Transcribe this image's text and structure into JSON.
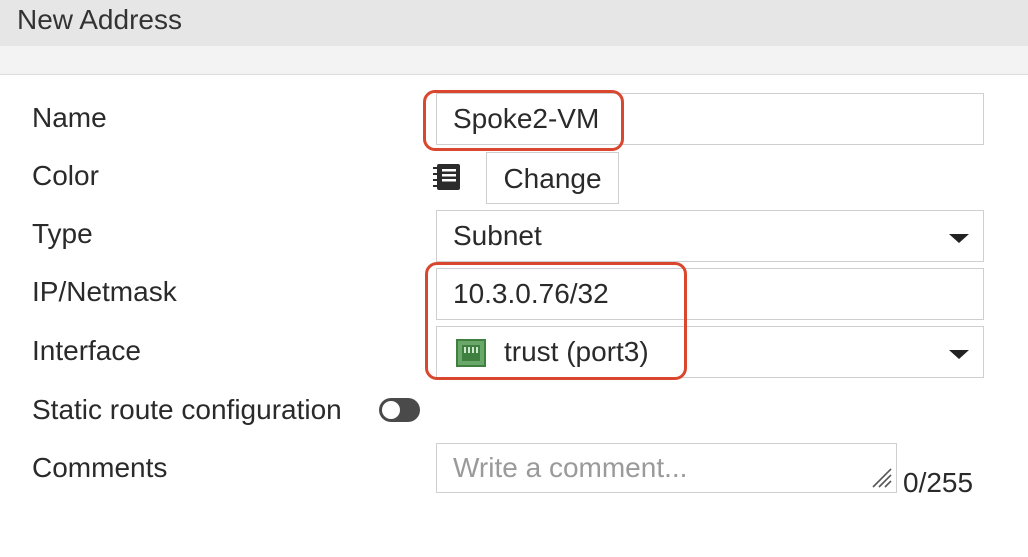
{
  "header": {
    "title": "New Address"
  },
  "form": {
    "name": {
      "label": "Name",
      "value": "Spoke2-VM"
    },
    "color": {
      "label": "Color",
      "icon": "color-swatch-icon",
      "change_label": "Change"
    },
    "type": {
      "label": "Type",
      "value": "Subnet"
    },
    "ip_netmask": {
      "label": "IP/Netmask",
      "value": "10.3.0.76/32"
    },
    "interface": {
      "label": "Interface",
      "value": "trust (port3)",
      "icon": "network-port-icon",
      "icon_color": "#4f9a4f"
    },
    "static_route": {
      "label": "Static route configuration",
      "enabled": false
    },
    "comments": {
      "label": "Comments",
      "placeholder": "Write a comment...",
      "value": "",
      "counter": "0/255"
    }
  },
  "colors": {
    "highlight": "#d9472f",
    "toggle_off": "#4a4a4a"
  }
}
